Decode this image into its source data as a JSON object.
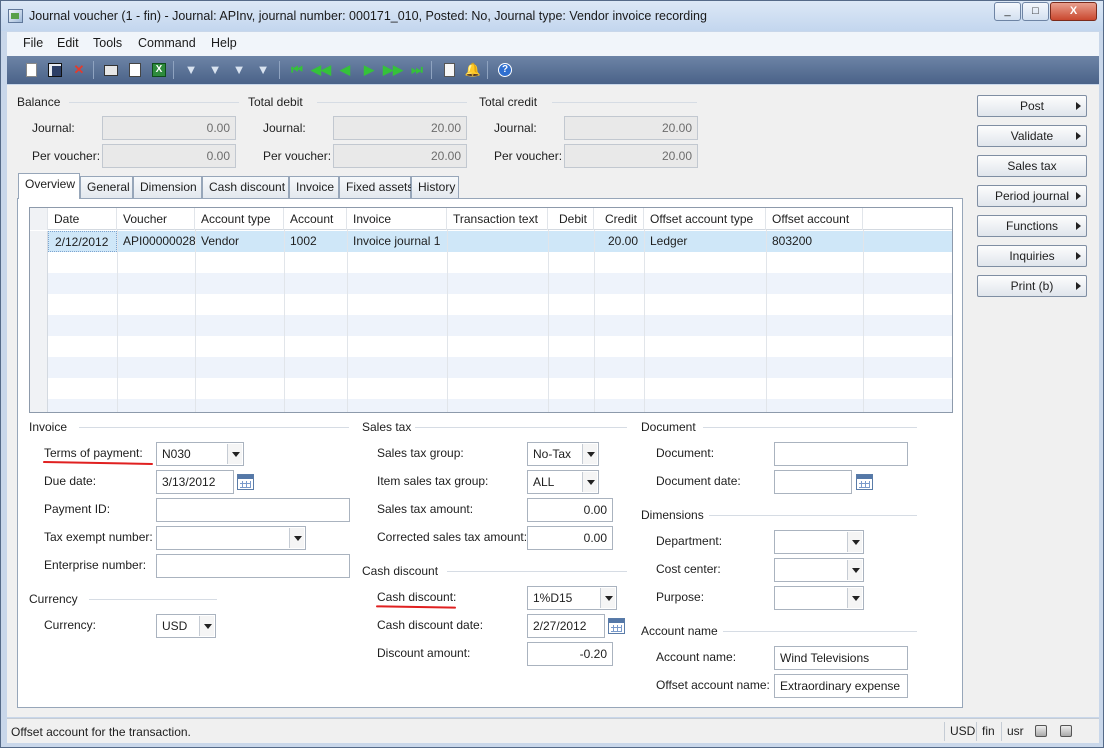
{
  "window": {
    "title": "Journal voucher (1 - fin) - Journal: APInv, journal number: 000171_010, Posted: No, Journal type: Vendor invoice recording",
    "minimize_label": "_",
    "maximize_label": "□",
    "close_label": "X"
  },
  "menu": {
    "file": "File",
    "edit": "Edit",
    "tools": "Tools",
    "command": "Command",
    "help": "Help"
  },
  "toolbar": {
    "icons": [
      "new-icon",
      "save-icon",
      "delete-icon",
      "print-icon",
      "print-preview-icon",
      "excel-icon",
      "filter-by-selection-icon",
      "filter-by-grid-icon",
      "advanced-filter-icon",
      "remove-filter-icon",
      "first-record-icon",
      "previous-page-icon",
      "previous-record-icon",
      "next-record-icon",
      "next-page-icon",
      "last-record-icon",
      "document-handling-icon",
      "alert-icon",
      "help-icon"
    ]
  },
  "summary": {
    "balance_label": "Balance",
    "total_debit_label": "Total debit",
    "total_credit_label": "Total credit",
    "journal_label": "Journal:",
    "per_voucher_label": "Per voucher:",
    "balance_journal": "0.00",
    "balance_per_voucher": "0.00",
    "debit_journal": "20.00",
    "debit_per_voucher": "20.00",
    "credit_journal": "20.00",
    "credit_per_voucher": "20.00"
  },
  "tabs": [
    "Overview",
    "General",
    "Dimension",
    "Cash discount",
    "Invoice",
    "Fixed assets",
    "History"
  ],
  "grid": {
    "headers": [
      "Date",
      "Voucher",
      "Account type",
      "Account",
      "Invoice",
      "Transaction text",
      "Debit",
      "Credit",
      "Offset account type",
      "Offset account"
    ],
    "rows": [
      {
        "date": "2/12/2012",
        "voucher": "API00000028",
        "account_type": "Vendor",
        "account": "1002",
        "invoice": "Invoice journal 1",
        "transaction_text": "",
        "debit": "",
        "credit": "20.00",
        "offset_account_type": "Ledger",
        "offset_account": "803200"
      }
    ]
  },
  "invoice": {
    "group": "Invoice",
    "terms_label": "Terms of payment:",
    "terms_value": "N030",
    "due_date_label": "Due date:",
    "due_date_value": "3/13/2012",
    "payment_id_label": "Payment ID:",
    "payment_id_value": "",
    "tax_exempt_label": "Tax exempt number:",
    "tax_exempt_value": "",
    "enterprise_label": "Enterprise number:",
    "enterprise_value": ""
  },
  "currency": {
    "group": "Currency",
    "label": "Currency:",
    "value": "USD"
  },
  "sales_tax": {
    "group": "Sales tax",
    "group_label": "Sales tax group:",
    "group_value": "No-Tax",
    "item_group_label": "Item sales tax group:",
    "item_group_value": "ALL",
    "amount_label": "Sales tax amount:",
    "amount_value": "0.00",
    "corrected_label": "Corrected sales tax amount:",
    "corrected_value": "0.00"
  },
  "cash_discount": {
    "group": "Cash discount",
    "label": "Cash discount:",
    "value": "1%D15",
    "date_label": "Cash discount date:",
    "date_value": "2/27/2012",
    "amount_label": "Discount amount:",
    "amount_value": "-0.20"
  },
  "document": {
    "group": "Document",
    "label": "Document:",
    "value": "",
    "date_label": "Document date:",
    "date_value": ""
  },
  "dimensions": {
    "group": "Dimensions",
    "department_label": "Department:",
    "department_value": "",
    "cost_center_label": "Cost center:",
    "cost_center_value": "",
    "purpose_label": "Purpose:",
    "purpose_value": ""
  },
  "account_name": {
    "group": "Account name",
    "label": "Account name:",
    "value": "Wind Televisions",
    "offset_label": "Offset account name:",
    "offset_value": "Extraordinary expense"
  },
  "actions": {
    "post": "Post",
    "validate": "Validate",
    "sales_tax": "Sales tax",
    "period_journal": "Period journal",
    "functions": "Functions",
    "inquiries": "Inquiries",
    "print": "Print (b)"
  },
  "status": {
    "help_text": "Offset account for the transaction.",
    "currency": "USD",
    "company": "fin",
    "user": "usr"
  }
}
